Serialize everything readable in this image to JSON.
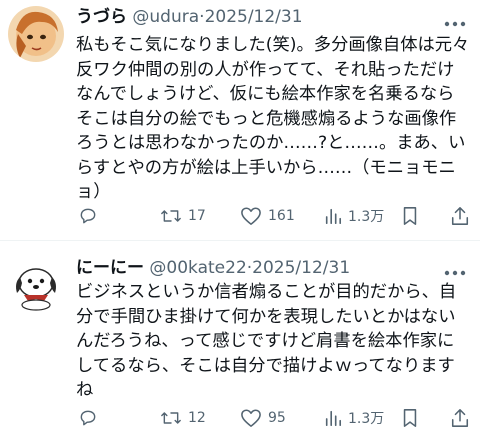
{
  "tweets": [
    {
      "name": "うづら",
      "handle": "@udura",
      "sep": "·",
      "date": "2025/12/31",
      "text": "私もそこ気になりました(笑)。多分画像自体は元々反ワク仲間の別の人が作ってて、それ貼っただけなんでしょうけど、仮にも絵本作家を名乗るならそこは自分の絵でもっと危機感煽るような画像作ろうとは思わなかったのか……?と……。まあ、いらすとやの方が絵は上手いから……（モニョモニョ）",
      "actions": {
        "replies": "",
        "retweets": "17",
        "likes": "161",
        "views": "1.3万"
      }
    },
    {
      "name": "にーにー",
      "handle": "@00kate22",
      "sep": "·",
      "date": "2025/12/31",
      "text": "ビジネスというか信者煽ることが目的だから、自分で手間ひま掛けて何かを表現したいとかはないんだろうね、って感じですけど肩書を絵本作家にしてるなら、そこは自分で描けよｗってなりますね",
      "actions": {
        "replies": "",
        "retweets": "12",
        "likes": "95",
        "views": "1.3万"
      }
    }
  ],
  "icons": [
    "more-icon",
    "reply-icon",
    "retweet-icon",
    "like-icon",
    "views-icon",
    "bookmark-icon",
    "share-icon"
  ],
  "colors": {
    "text": "#0f1419",
    "secondary": "#536471",
    "divider": "#eff3f4"
  }
}
